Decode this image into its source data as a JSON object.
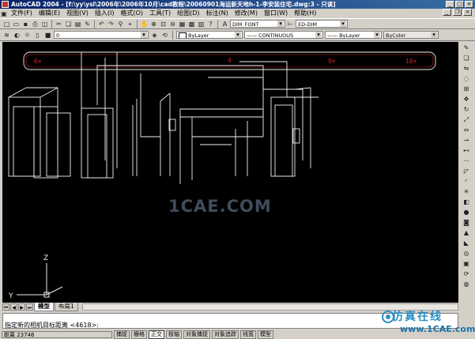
{
  "window": {
    "title": "AutoCAD 2004 - [f:\\yy\\ysl\\2006年\\2006年10月\\cad教程\\20060901海运新天地h-1-李安装住宅.dwg:3 - 只读]"
  },
  "menu": {
    "items": [
      "文件(F)",
      "编辑(E)",
      "视图(V)",
      "插入(I)",
      "格式(O)",
      "工具(T)",
      "绘图(D)",
      "标注(N)",
      "修改(M)",
      "窗口(W)",
      "帮助(H)"
    ]
  },
  "toolbar": {
    "layer_value": "0",
    "text_style": "DIM_FONT",
    "dim_style": "ED-DIM"
  },
  "properties": {
    "color": "ByLayer",
    "linetype": "CONTINUOUS",
    "lineweight": "ByLayer",
    "plotstyle": "ByColor"
  },
  "drawing": {
    "background": "#000000",
    "line_color": "#f0f0f0",
    "accent_color": "#cc2222",
    "labels": [
      "6×",
      "4",
      "9×",
      "16×"
    ],
    "watermark": "1CAE.COM",
    "ucs_z": "Z",
    "ucs_y": "Y"
  },
  "tabs": {
    "model": "模型",
    "layout1": "布局1"
  },
  "command": {
    "prev_line": "",
    "prompt": "指定新的相机目标距离 <4618>:"
  },
  "status": {
    "coords": "距离 23746",
    "buttons": [
      "捕捉",
      "栅格",
      "正交",
      "极轴",
      "对象捕捉",
      "对象追踪",
      "线宽",
      "模型"
    ]
  },
  "logo": {
    "text_cn": "仿真在线",
    "text_en": "www.1CAE.com",
    "color": "#2a8fc7"
  }
}
